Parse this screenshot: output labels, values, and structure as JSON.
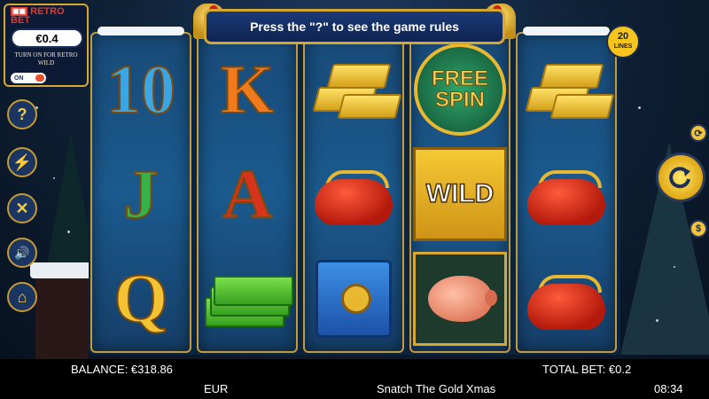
{
  "banner": {
    "text": "Press the \"?\" to see the game rules"
  },
  "lines_badge": {
    "number": "20",
    "label": "LINES"
  },
  "retro": {
    "logo_line1": "RETRO",
    "logo_line2": "BET",
    "bet_value": "€0.4",
    "description": "TURN ON FOR RETRO WILD",
    "toggle_label": "ON"
  },
  "side_menu": [
    {
      "name": "help",
      "glyph": "?"
    },
    {
      "name": "turbo",
      "glyph": "⚡"
    },
    {
      "name": "settings",
      "glyph": "✕"
    },
    {
      "name": "sound",
      "glyph": "🔊"
    },
    {
      "name": "home",
      "glyph": "⌂"
    }
  ],
  "reels": [
    [
      "10",
      "J",
      "Q"
    ],
    [
      "K",
      "A",
      "cash-stack"
    ],
    [
      "gold-bars",
      "purse",
      "safe"
    ],
    [
      "FREE SPIN",
      "WILD",
      "piggy-bank"
    ],
    [
      "gold-bars",
      "purse",
      "purse"
    ]
  ],
  "symbol_text": {
    "ten": "10",
    "jack": "J",
    "queen": "Q",
    "king": "K",
    "ace": "A",
    "free_line1": "FREE",
    "free_line2": "SPIN",
    "wild": "WILD"
  },
  "controls": {
    "spin_icon": "refresh-icon",
    "autoplay_icon": "autoplay-icon",
    "currency_icon": "$"
  },
  "footer": {
    "balance": "BALANCE: €318.86",
    "total_bet": "TOTAL BET: €0.2",
    "currency": "EUR",
    "game_title": "Snatch The Gold Xmas",
    "clock": "08:34"
  },
  "colors": {
    "gold": "#d4a632",
    "reel_blue": "#1b5a8e",
    "panel_navy": "#0c1a36"
  }
}
